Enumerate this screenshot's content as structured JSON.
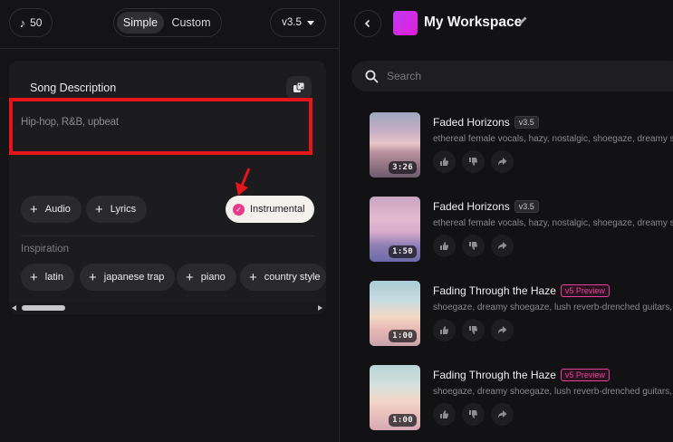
{
  "header": {
    "credits": "50",
    "modes": [
      "Simple",
      "Custom"
    ],
    "active_mode": "Simple",
    "version": "v3.5"
  },
  "create_card": {
    "title": "Song Description",
    "description_value": "Hip-hop, R&B, upbeat",
    "buttons": {
      "audio": "Audio",
      "lyrics": "Lyrics",
      "instrumental": "Instrumental"
    },
    "instrumental_checked": true,
    "inspiration_label": "Inspiration",
    "inspiration_tags": [
      "latin",
      "japanese trap",
      "piano",
      "country style"
    ]
  },
  "workspace": {
    "title": "My Workspace",
    "search_placeholder": "Search",
    "songs": [
      {
        "title": "Faded Horizons",
        "tag": "v3.5",
        "desc": "ethereal female vocals, hazy, nostalgic, shoegaze, dreamy shoe",
        "duration": "3:26"
      },
      {
        "title": "Faded Horizons",
        "tag": "v3.5",
        "desc": "ethereal female vocals, hazy, nostalgic, shoegaze, dreamy shoe",
        "duration": "1:50"
      },
      {
        "title": "Fading Through the Haze",
        "tag": "v5 Preview",
        "desc": "shoegaze, dreamy shoegaze, lush reverb-drenched guitars, so",
        "duration": "1:00"
      },
      {
        "title": "Fading Through the Haze",
        "tag": "v5 Preview",
        "desc": "shoegaze, dreamy shoegaze, lush reverb-drenched guitars, so",
        "duration": "1:00"
      }
    ]
  },
  "colors": {
    "accent_pink": "#e83a8a",
    "annotation_red": "#e8141c",
    "workspace_thumb": "#d42ae0"
  }
}
